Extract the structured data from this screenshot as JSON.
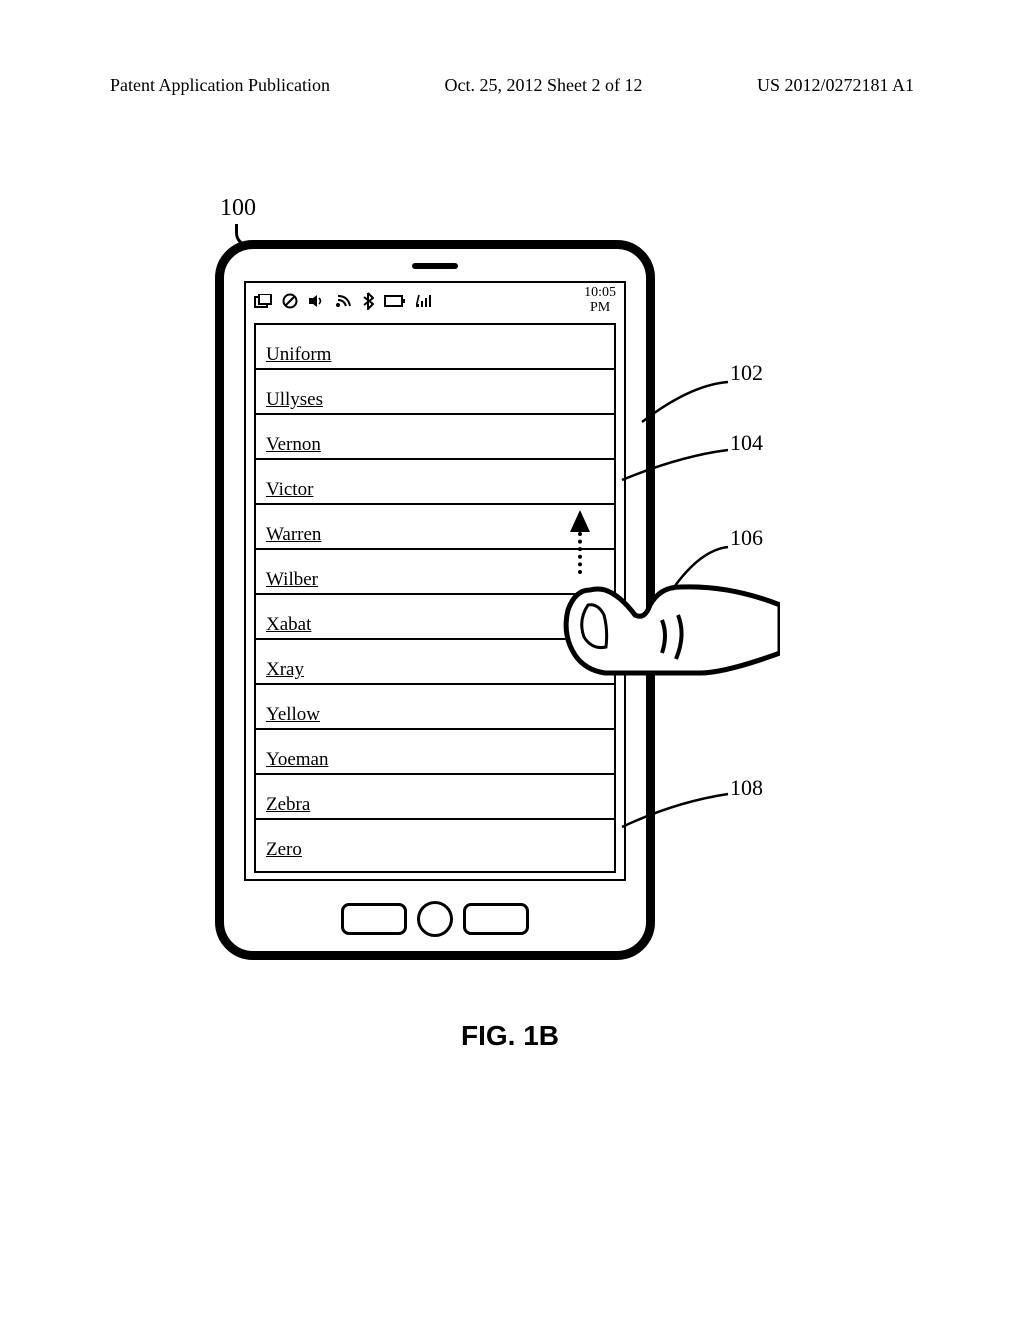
{
  "header": {
    "left": "Patent Application Publication",
    "center": "Oct. 25, 2012  Sheet 2 of 12",
    "right": "US 2012/0272181 A1"
  },
  "device_ref": "100",
  "status": {
    "time_top": "10:05",
    "time_bottom": "PM"
  },
  "list": {
    "items": [
      {
        "label": "Uniform"
      },
      {
        "label": "Ullyses"
      },
      {
        "label": "Vernon"
      },
      {
        "label": "Victor"
      },
      {
        "label": "Warren"
      },
      {
        "label": "Wilber"
      },
      {
        "label": "Xabat"
      },
      {
        "label": "Xray"
      },
      {
        "label": "Yellow"
      },
      {
        "label": "Yoeman"
      },
      {
        "label": "Zebra"
      },
      {
        "label": "Zero"
      }
    ]
  },
  "refs": {
    "r102": "102",
    "r104": "104",
    "r106": "106",
    "r108": "108"
  },
  "caption": "FIG. 1B"
}
